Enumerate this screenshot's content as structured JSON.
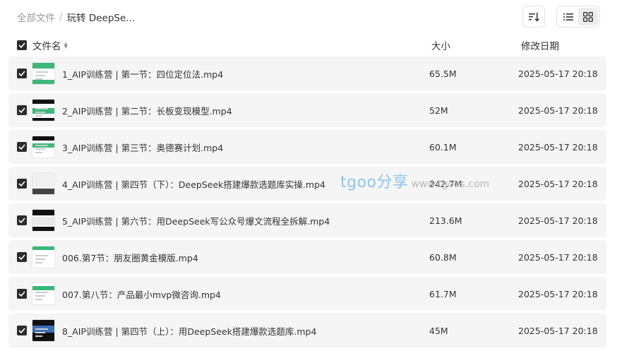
{
  "breadcrumb": {
    "root": "全部文件",
    "separator": "/",
    "current": "玩转 DeepSe..."
  },
  "toolbar": {
    "sort_icon": "sort-lines-icon",
    "list_view_icon": "list-view-icon",
    "grid_view_icon": "grid-view-icon",
    "active_view": "grid"
  },
  "table": {
    "headers": {
      "name": "文件名",
      "size": "大小",
      "date": "修改日期"
    },
    "rows": [
      {
        "name": "1_AIP训练营 | 第一节：四位定位法.mp4",
        "size": "65.5M",
        "date": "2025-05-17 20:18"
      },
      {
        "name": "2_AIP训练营 | 第二节：长板变现模型.mp4",
        "size": "52M",
        "date": "2025-05-17 20:18"
      },
      {
        "name": "3_AIP训练营 | 第三节：奥德赛计划.mp4",
        "size": "60.1M",
        "date": "2025-05-17 20:18"
      },
      {
        "name": "4_AIP训练营 | 第四节（下）：DeepSeek搭建爆款选题库实操.mp4",
        "size": "242.7M",
        "date": "2025-05-17 20:18"
      },
      {
        "name": "5_AIP训练营 | 第六节：用DeepSeek写公众号爆文流程全拆解.mp4",
        "size": "213.6M",
        "date": "2025-05-17 20:18"
      },
      {
        "name": "006.第7节：朋友圈黄金模版.mp4",
        "size": "60.8M",
        "date": "2025-05-17 20:18"
      },
      {
        "name": "007.第八节：产品最小mvp微咨询.mp4",
        "size": "61.7M",
        "date": "2025-05-17 20:18"
      },
      {
        "name": "8_AIP训练营 | 第四节（上）：用DeepSeek搭建爆款选题库.mp4",
        "size": "45M",
        "date": "2025-05-17 20:18"
      }
    ]
  },
  "watermark": {
    "logo": "tgoo分享",
    "url": "www.tgoos.com"
  },
  "colors": {
    "checkbox": "#2b2b2b",
    "row_bg": "#f5f5f5",
    "thumb_green": "#3cb878",
    "watermark_blue": "#8ec5e8"
  }
}
